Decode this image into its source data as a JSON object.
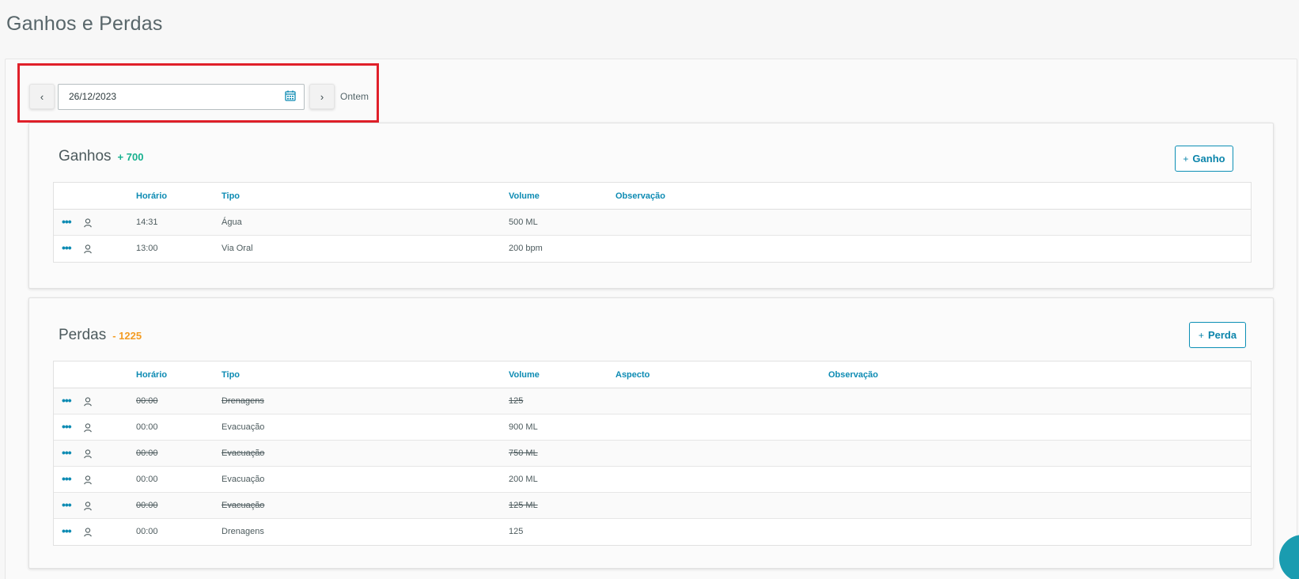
{
  "page": {
    "title": "Ganhos e Perdas"
  },
  "date_nav": {
    "prev_label": "‹",
    "date_value": "26/12/2023",
    "next_label": "›",
    "shortcut_label": "Ontem"
  },
  "gains": {
    "title": "Ganhos",
    "total": "+ 700",
    "add_button": "Ganho",
    "add_plus": "+",
    "columns": [
      "Horário",
      "Tipo",
      "Volume",
      "Observação"
    ],
    "rows": [
      {
        "time": "14:31",
        "type": "Água",
        "volume": "500 ML",
        "note": ""
      },
      {
        "time": "13:00",
        "type": "Via Oral",
        "volume": "200 bpm",
        "note": ""
      }
    ]
  },
  "losses": {
    "title": "Perdas",
    "total": "- 1225",
    "add_button": "Perda",
    "add_plus": "+",
    "columns": [
      "Horário",
      "Tipo",
      "Volume",
      "Aspecto",
      "Observação"
    ],
    "rows": [
      {
        "time": "00:00",
        "type": "Drenagens",
        "volume": "125",
        "aspect": "",
        "note": "",
        "canceled": true
      },
      {
        "time": "00:00",
        "type": "Evacuação",
        "volume": "900 ML",
        "aspect": "",
        "note": "",
        "canceled": false
      },
      {
        "time": "00:00",
        "type": "Evacuação",
        "volume": "750 ML",
        "aspect": "",
        "note": "",
        "canceled": true
      },
      {
        "time": "00:00",
        "type": "Evacuação",
        "volume": "200 ML",
        "aspect": "",
        "note": "",
        "canceled": false
      },
      {
        "time": "00:00",
        "type": "Evacuação",
        "volume": "125 ML",
        "aspect": "",
        "note": "",
        "canceled": true
      },
      {
        "time": "00:00",
        "type": "Drenagens",
        "volume": "125",
        "aspect": "",
        "note": "",
        "canceled": false
      }
    ]
  },
  "row_menu_icon": "more-horizontal-icon",
  "row_user_icon": "user-icon",
  "colors": {
    "accent": "#0d8bb3",
    "gain": "#16b08e",
    "loss": "#f39c24",
    "highlight": "#e0202a"
  }
}
